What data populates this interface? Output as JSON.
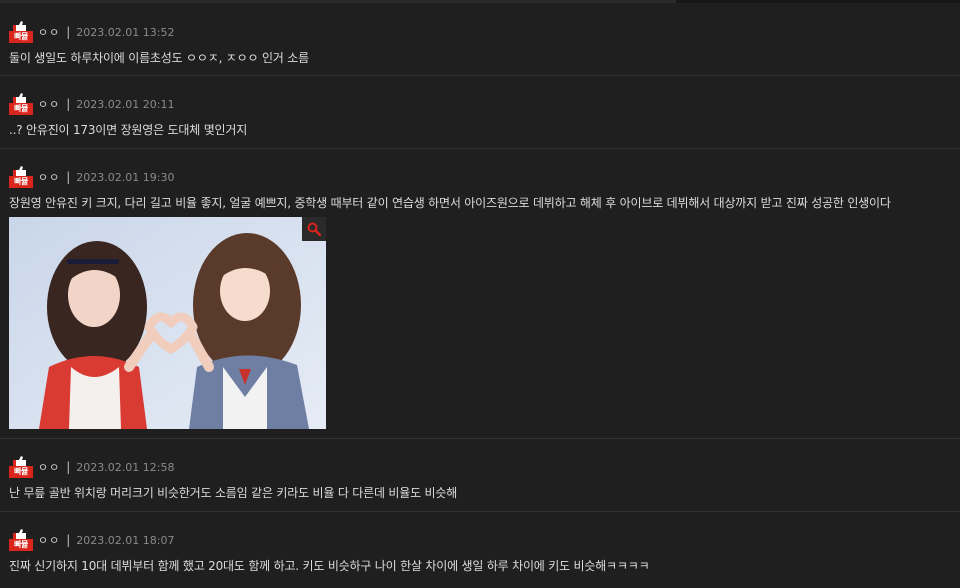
{
  "comments": [
    {
      "badge_label": "빠뮬",
      "nickname": "ㅇㅇ",
      "separator": "|",
      "date": "2023.02.01 13:52",
      "text": "둘이 생일도 하루차이에 이름초성도 ㅇㅇㅈ, ㅈㅇㅇ 인거 소름"
    },
    {
      "badge_label": "빠뮬",
      "nickname": "ㅇㅇ",
      "separator": "|",
      "date": "2023.02.01 20:11",
      "text": "..? 안유진이 173이면 장원영은 도대체 몇인거지"
    },
    {
      "badge_label": "빠뮬",
      "nickname": "ㅇㅇ",
      "separator": "|",
      "date": "2023.02.01 19:30",
      "text": "장원영 안유진 키 크지, 다리 길고 비율 좋지, 얼굴 예쁘지, 중학생 때부터 같이 연습생 하면서 아이즈원으로 데뷔하고 해체 후 아이브로 데뷔해서 대상까지 받고 진짜 성공한 인생이다"
    },
    {
      "badge_label": "빠뮬",
      "nickname": "ㅇㅇ",
      "separator": "|",
      "date": "2023.02.01 12:58",
      "text": "난 무릎 골반 위치랑 머리크기 비슷한거도 소름임 같은 키라도 비율 다 다른데 비율도 비슷해"
    },
    {
      "badge_label": "빠뮬",
      "nickname": "ㅇㅇ",
      "separator": "|",
      "date": "2023.02.01 18:07",
      "text": "진짜 신기하지 10대 데뷔부터 함께 했고 20대도 함께 하고. 키도 비슷하구 나이 한살 차이에 생일 하루 차이에 키도 비슷해ㅋㅋㅋㅋ"
    }
  ],
  "icons": {
    "badge": "thumbs-up-icon",
    "zoom": "search-icon"
  },
  "colors": {
    "background": "#1f1f1f",
    "badge_red": "#d9251c",
    "zoom_icon": "#d9251c",
    "divider": "#333333"
  }
}
